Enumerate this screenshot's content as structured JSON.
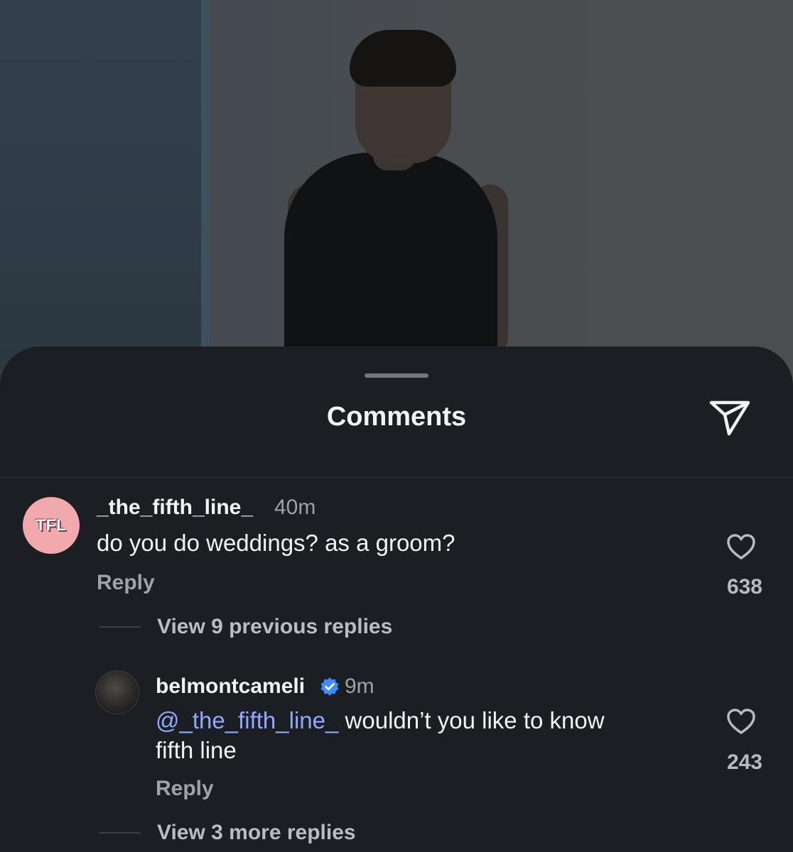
{
  "sheet": {
    "title": "Comments",
    "send_icon": "paper-plane-icon"
  },
  "comments": [
    {
      "avatar_text": "TFL",
      "username": "_the_fifth_line_",
      "time": "40m",
      "text": "do you do weddings? as a groom?",
      "reply_label": "Reply",
      "likes": "638",
      "view_replies": "View 9 previous replies"
    },
    {
      "username": "belmontcameli",
      "verified": true,
      "time": "9m",
      "mention": "@_the_fifth_line_",
      "text_line1": " wouldn’t you like to know",
      "text_line2": "fifth line",
      "reply_label": "Reply",
      "likes": "243",
      "view_replies": "View 3 more replies"
    }
  ],
  "colors": {
    "background": "#1b1e22",
    "mention": "#93a8ff",
    "verified": "#3d8bff"
  }
}
